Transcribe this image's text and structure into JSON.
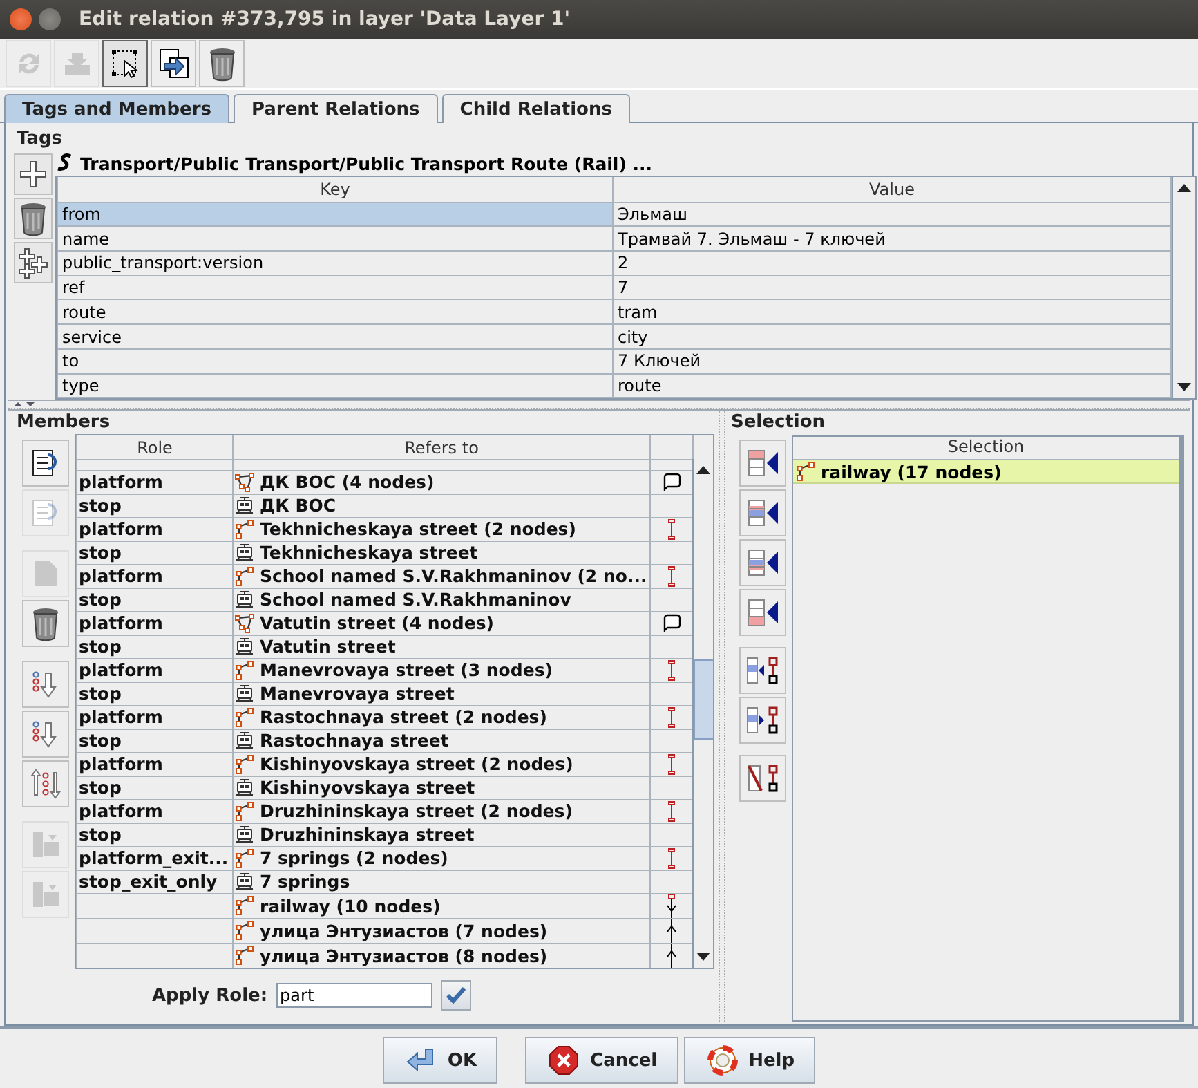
{
  "window": {
    "title": "Edit relation #373,795 in layer 'Data Layer 1'"
  },
  "toolbar": [
    {
      "kind": "refresh",
      "disabled": true,
      "pressed": false
    },
    {
      "kind": "tray",
      "disabled": true,
      "pressed": false
    },
    {
      "kind": "select",
      "disabled": false,
      "pressed": true
    },
    {
      "kind": "copy",
      "disabled": false,
      "pressed": false
    },
    {
      "kind": "trash",
      "disabled": false,
      "pressed": false
    }
  ],
  "tabs": [
    {
      "label": "Tags and Members",
      "selected": true
    },
    {
      "label": "Parent Relations",
      "selected": false
    },
    {
      "label": "Child Relations",
      "selected": false
    }
  ],
  "tags": {
    "title": "Tags",
    "preset": "Transport/Public Transport/Public Transport Route (Rail) ...",
    "buttons": [
      {
        "kind": "plus"
      },
      {
        "kind": "trash"
      },
      {
        "kind": "paste"
      }
    ],
    "columns": [
      "Key",
      "Value"
    ],
    "rows": [
      {
        "key": "from",
        "value": "Эльмаш",
        "selected": true
      },
      {
        "key": "name",
        "value": "Трамвай 7. Эльмаш - 7 ключей",
        "selected": false
      },
      {
        "key": "public_transport:version",
        "value": "2",
        "selected": false
      },
      {
        "key": "ref",
        "value": "7",
        "selected": false
      },
      {
        "key": "route",
        "value": "tram",
        "selected": false
      },
      {
        "key": "service",
        "value": "city",
        "selected": false
      },
      {
        "key": "to",
        "value": "7 Ключей",
        "selected": false
      },
      {
        "key": "type",
        "value": "route",
        "selected": false
      }
    ]
  },
  "members": {
    "title": "Members",
    "button_groups": [
      {
        "buttons": [
          {
            "kind": "list-up",
            "disabled": false
          },
          {
            "kind": "list-down",
            "disabled": true
          }
        ]
      },
      {
        "buttons": [
          {
            "kind": "edit",
            "disabled": true
          },
          {
            "kind": "trash",
            "disabled": false
          }
        ]
      },
      {
        "buttons": [
          {
            "kind": "dots-down",
            "disabled": false
          },
          {
            "kind": "dots-down",
            "disabled": false
          },
          {
            "kind": "sort",
            "disabled": false
          }
        ]
      },
      {
        "buttons": [
          {
            "kind": "stack",
            "disabled": true
          },
          {
            "kind": "stack",
            "disabled": true
          }
        ]
      }
    ],
    "columns": [
      "Role",
      "Refers to"
    ],
    "rows": [
      {
        "role": "platform",
        "refers_to": "ДК ВОС (4 nodes)",
        "icon": {
          "kind": "area"
        },
        "link": {
          "kind": "loop"
        }
      },
      {
        "role": "stop",
        "refers_to": "ДК ВОС",
        "icon": {
          "kind": "stop"
        }
      },
      {
        "role": "platform",
        "refers_to": "Tekhnicheskaya street (2 nodes)",
        "icon": {
          "kind": "way"
        },
        "link": {
          "kind": "segment"
        }
      },
      {
        "role": "stop",
        "refers_to": "Tekhnicheskaya street",
        "icon": {
          "kind": "stop"
        }
      },
      {
        "role": "platform",
        "refers_to": "School named S.V.Rakhmaninov (2 no...",
        "icon": {
          "kind": "way"
        },
        "link": {
          "kind": "segment"
        }
      },
      {
        "role": "stop",
        "refers_to": "School named S.V.Rakhmaninov",
        "icon": {
          "kind": "stop"
        }
      },
      {
        "role": "platform",
        "refers_to": "Vatutin street (4 nodes)",
        "icon": {
          "kind": "area"
        },
        "link": {
          "kind": "loop"
        }
      },
      {
        "role": "stop",
        "refers_to": "Vatutin street",
        "icon": {
          "kind": "stop"
        }
      },
      {
        "role": "platform",
        "refers_to": "Manevrovaya street (3 nodes)",
        "icon": {
          "kind": "way"
        },
        "link": {
          "kind": "segment"
        }
      },
      {
        "role": "stop",
        "refers_to": "Manevrovaya street",
        "icon": {
          "kind": "stop"
        }
      },
      {
        "role": "platform",
        "refers_to": "Rastochnaya street (2 nodes)",
        "icon": {
          "kind": "way"
        },
        "link": {
          "kind": "segment"
        }
      },
      {
        "role": "stop",
        "refers_to": "Rastochnaya street",
        "icon": {
          "kind": "stop"
        }
      },
      {
        "role": "platform",
        "refers_to": "Kishinyovskaya street (2 nodes)",
        "icon": {
          "kind": "way"
        },
        "link": {
          "kind": "segment"
        }
      },
      {
        "role": "stop",
        "refers_to": "Kishinyovskaya street",
        "icon": {
          "kind": "stop"
        }
      },
      {
        "role": "platform",
        "refers_to": "Druzhininskaya street (2 nodes)",
        "icon": {
          "kind": "way"
        },
        "link": {
          "kind": "segment"
        }
      },
      {
        "role": "stop",
        "refers_to": "Druzhininskaya street",
        "icon": {
          "kind": "stop"
        }
      },
      {
        "role": "platform_exit...",
        "refers_to": "7 springs (2 nodes)",
        "icon": {
          "kind": "way"
        },
        "link": {
          "kind": "segment"
        }
      },
      {
        "role": "stop_exit_only",
        "refers_to": "7 springs",
        "icon": {
          "kind": "stop"
        }
      },
      {
        "role": "",
        "refers_to": "railway (10 nodes)",
        "icon": {
          "kind": "way"
        },
        "link": {
          "kind": "down"
        }
      },
      {
        "role": "",
        "refers_to": "улица Энтузиастов (7 nodes)",
        "icon": {
          "kind": "way"
        },
        "link": {
          "kind": "up"
        }
      },
      {
        "role": "",
        "refers_to": "улица Энтузиастов (8 nodes)",
        "icon": {
          "kind": "way"
        },
        "link": {
          "kind": "up"
        }
      }
    ],
    "apply_role": {
      "label": "Apply Role:",
      "value": "part"
    }
  },
  "selection": {
    "title": "Selection",
    "button_groups": [
      {
        "buttons": [
          {
            "kind": "add-top"
          },
          {
            "kind": "add-before"
          },
          {
            "kind": "add-after"
          },
          {
            "kind": "add-bottom"
          }
        ]
      },
      {
        "buttons": [
          {
            "kind": "select-before"
          },
          {
            "kind": "select-after"
          }
        ]
      },
      {
        "buttons": [
          {
            "kind": "remove"
          }
        ]
      }
    ],
    "column": "Selection",
    "rows": [
      {
        "label": "railway (17 nodes)",
        "icon": {
          "kind": "way"
        }
      }
    ]
  },
  "buttons": [
    {
      "label": "OK",
      "kind": "ok"
    },
    {
      "label": "Cancel",
      "kind": "cancel"
    },
    {
      "label": "Help",
      "kind": "help"
    }
  ]
}
